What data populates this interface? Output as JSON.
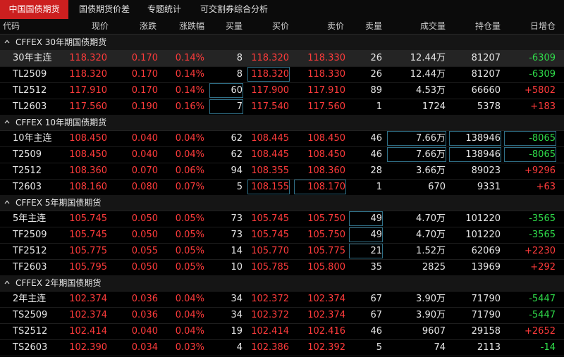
{
  "tabs": [
    {
      "label": "中国国债期货",
      "active": true
    },
    {
      "label": "国债期货价差",
      "active": false
    },
    {
      "label": "专题统计",
      "active": false
    },
    {
      "label": "可交割券综合分析",
      "active": false
    }
  ],
  "columns": [
    "代码",
    "现价",
    "涨跌",
    "涨跌幅",
    "买量",
    "买价",
    "卖价",
    "卖量",
    "成交量",
    "持仓量",
    "日增仓"
  ],
  "groups": [
    {
      "title": "CFFEX 30年期国债期货",
      "rows": [
        {
          "code": "30年主连",
          "price": "118.320",
          "chg": "0.170",
          "pct": "0.14%",
          "bidvol": "8",
          "bid": "118.320",
          "ask": "118.330",
          "askvol": "26",
          "volume": "12.44万",
          "oi": "81207",
          "oichg": "-6309"
        },
        {
          "code": "TL2509",
          "price": "118.320",
          "chg": "0.170",
          "pct": "0.14%",
          "bidvol": "8",
          "bid": "118.320",
          "ask": "118.330",
          "askvol": "26",
          "volume": "12.44万",
          "oi": "81207",
          "oichg": "-6309"
        },
        {
          "code": "TL2512",
          "price": "117.910",
          "chg": "0.170",
          "pct": "0.14%",
          "bidvol": "60",
          "bid": "117.900",
          "ask": "117.910",
          "askvol": "89",
          "volume": "4.53万",
          "oi": "66660",
          "oichg": "+5802"
        },
        {
          "code": "TL2603",
          "price": "117.560",
          "chg": "0.190",
          "pct": "0.16%",
          "bidvol": "7",
          "bid": "117.540",
          "ask": "117.560",
          "askvol": "1",
          "volume": "1724",
          "oi": "5378",
          "oichg": "+183"
        }
      ]
    },
    {
      "title": "CFFEX 10年期国债期货",
      "rows": [
        {
          "code": "10年主连",
          "price": "108.450",
          "chg": "0.040",
          "pct": "0.04%",
          "bidvol": "62",
          "bid": "108.445",
          "ask": "108.450",
          "askvol": "46",
          "volume": "7.66万",
          "oi": "138946",
          "oichg": "-8065"
        },
        {
          "code": "T2509",
          "price": "108.450",
          "chg": "0.040",
          "pct": "0.04%",
          "bidvol": "62",
          "bid": "108.445",
          "ask": "108.450",
          "askvol": "46",
          "volume": "7.66万",
          "oi": "138946",
          "oichg": "-8065"
        },
        {
          "code": "T2512",
          "price": "108.360",
          "chg": "0.070",
          "pct": "0.06%",
          "bidvol": "94",
          "bid": "108.355",
          "ask": "108.360",
          "askvol": "28",
          "volume": "3.66万",
          "oi": "89023",
          "oichg": "+9296"
        },
        {
          "code": "T2603",
          "price": "108.160",
          "chg": "0.080",
          "pct": "0.07%",
          "bidvol": "5",
          "bid": "108.155",
          "ask": "108.170",
          "askvol": "1",
          "volume": "670",
          "oi": "9331",
          "oichg": "+63"
        }
      ]
    },
    {
      "title": "CFFEX 5年期国债期货",
      "rows": [
        {
          "code": "5年主连",
          "price": "105.745",
          "chg": "0.050",
          "pct": "0.05%",
          "bidvol": "73",
          "bid": "105.745",
          "ask": "105.750",
          "askvol": "49",
          "volume": "4.70万",
          "oi": "101220",
          "oichg": "-3565"
        },
        {
          "code": "TF2509",
          "price": "105.745",
          "chg": "0.050",
          "pct": "0.05%",
          "bidvol": "73",
          "bid": "105.745",
          "ask": "105.750",
          "askvol": "49",
          "volume": "4.70万",
          "oi": "101220",
          "oichg": "-3565"
        },
        {
          "code": "TF2512",
          "price": "105.775",
          "chg": "0.055",
          "pct": "0.05%",
          "bidvol": "14",
          "bid": "105.770",
          "ask": "105.775",
          "askvol": "21",
          "volume": "1.52万",
          "oi": "62069",
          "oichg": "+2230"
        },
        {
          "code": "TF2603",
          "price": "105.795",
          "chg": "0.050",
          "pct": "0.05%",
          "bidvol": "10",
          "bid": "105.785",
          "ask": "105.800",
          "askvol": "35",
          "volume": "2825",
          "oi": "13969",
          "oichg": "+292"
        }
      ]
    },
    {
      "title": "CFFEX 2年期国债期货",
      "rows": [
        {
          "code": "2年主连",
          "price": "102.374",
          "chg": "0.036",
          "pct": "0.04%",
          "bidvol": "34",
          "bid": "102.372",
          "ask": "102.374",
          "askvol": "67",
          "volume": "3.90万",
          "oi": "71790",
          "oichg": "-5447"
        },
        {
          "code": "TS2509",
          "price": "102.374",
          "chg": "0.036",
          "pct": "0.04%",
          "bidvol": "34",
          "bid": "102.372",
          "ask": "102.374",
          "askvol": "67",
          "volume": "3.90万",
          "oi": "71790",
          "oichg": "-5447"
        },
        {
          "code": "TS2512",
          "price": "102.414",
          "chg": "0.040",
          "pct": "0.04%",
          "bidvol": "19",
          "bid": "102.414",
          "ask": "102.416",
          "askvol": "46",
          "volume": "9607",
          "oi": "29158",
          "oichg": "+2652"
        },
        {
          "code": "TS2603",
          "price": "102.390",
          "chg": "0.034",
          "pct": "0.03%",
          "bidvol": "4",
          "bid": "102.386",
          "ask": "102.392",
          "askvol": "5",
          "volume": "74",
          "oi": "2113",
          "oichg": "-14"
        }
      ]
    }
  ],
  "colors": {
    "up": "#ff3b3b",
    "down": "#2fdc4a",
    "active_tab": "#cc1f1f",
    "box": "#2f6f86"
  }
}
